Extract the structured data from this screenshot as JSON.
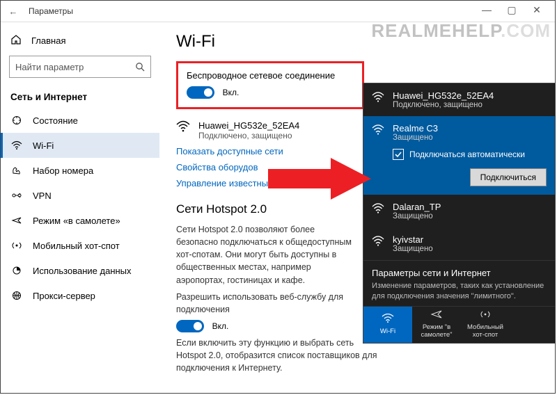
{
  "window": {
    "title": "Параметры"
  },
  "watermark": {
    "a": "REALMEHELP",
    "b": ".COM"
  },
  "sidebar": {
    "home": "Главная",
    "search_placeholder": "Найти параметр",
    "section": "Сеть и Интернет",
    "items": [
      {
        "label": "Состояние"
      },
      {
        "label": "Wi-Fi"
      },
      {
        "label": "Набор номера"
      },
      {
        "label": "VPN"
      },
      {
        "label": "Режим «в самолете»"
      },
      {
        "label": "Мобильный хот-спот"
      },
      {
        "label": "Использование данных"
      },
      {
        "label": "Прокси-сервер"
      }
    ]
  },
  "main": {
    "heading": "Wi-Fi",
    "wireless_label": "Беспроводное сетевое соединение",
    "toggle_on": "Вкл.",
    "connected": {
      "name": "Huawei_HG532e_52EA4",
      "status": "Подключено, защищено"
    },
    "links": {
      "show": "Показать доступные сети",
      "props": "Свойства оборудов",
      "manage": "Управление известными сетями"
    },
    "hotspot": {
      "heading": "Сети Hotspot 2.0",
      "p1": "Сети Hotspot 2.0 позволяют более безопасно подключаться к общедоступным хот-спотам. Они могут быть доступны в общественных местах, например аэропортах, гостиницах и кафе.",
      "allow": "Разрешить использовать веб-службу для подключения",
      "toggle": "Вкл.",
      "p2": "Если включить эту функцию и выбрать сеть Hotspot 2.0, отобразится список поставщиков для подключения к Интернету."
    }
  },
  "flyout": {
    "networks": [
      {
        "name": "Huawei_HG532e_52EA4",
        "status": "Подключено, защищено"
      },
      {
        "name": "Realme C3",
        "status": "Защищено",
        "auto": "Подключаться автоматически",
        "connect": "Подключиться"
      },
      {
        "name": "Dalaran_TP",
        "status": "Защищено"
      },
      {
        "name": "kyivstar",
        "status": "Защищено"
      }
    ],
    "footer": {
      "title": "Параметры сети и Интернет",
      "desc": "Изменение параметров, таких как установление для подключения значения \"лимитного\"."
    },
    "bar": [
      {
        "label": "Wi-Fi"
      },
      {
        "label": "Режим \"в самолете\""
      },
      {
        "label": "Мобильный хот-спот"
      }
    ]
  }
}
